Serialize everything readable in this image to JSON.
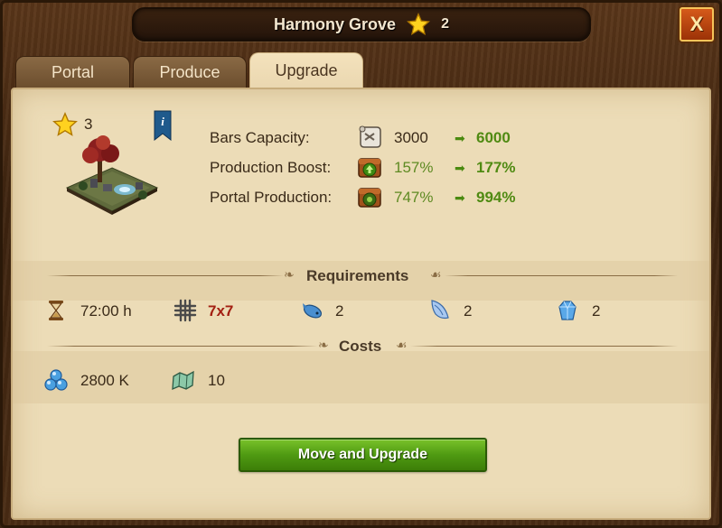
{
  "window": {
    "title": "Harmony Grove",
    "star_count": "2",
    "close_label": "X"
  },
  "tabs": [
    {
      "label": "Portal",
      "active": false
    },
    {
      "label": "Produce",
      "active": false
    },
    {
      "label": "Upgrade",
      "active": true
    }
  ],
  "building": {
    "level": "3",
    "info_icon": "info-bookmark-icon"
  },
  "stats": [
    {
      "label": "Bars Capacity:",
      "icon": "scroll-icon",
      "old": "3000",
      "new": "6000",
      "old_color": "#3a2a18"
    },
    {
      "label": "Production Boost:",
      "icon": "boost-chest-icon",
      "old": "157%",
      "new": "177%",
      "old_color": "#5e8a22"
    },
    {
      "label": "Portal Production:",
      "icon": "portal-chest-icon",
      "old": "747%",
      "new": "994%",
      "old_color": "#5e8a22"
    }
  ],
  "requirements": {
    "title": "Requirements",
    "items": [
      {
        "icon": "hourglass-icon",
        "value": "72:00 h",
        "color": "#3a2a18"
      },
      {
        "icon": "grid-size-icon",
        "value": "7x7",
        "color": "#a31f12"
      },
      {
        "icon": "blue-fish-icon",
        "value": "2"
      },
      {
        "icon": "wing-icon",
        "value": "2"
      },
      {
        "icon": "crystal-icon",
        "value": "2"
      }
    ]
  },
  "costs": {
    "title": "Costs",
    "items": [
      {
        "icon": "orb-cluster-icon",
        "value": "2800 K"
      },
      {
        "icon": "map-icon",
        "value": "10"
      }
    ]
  },
  "action": {
    "label": "Move and Upgrade"
  },
  "colors": {
    "accent_green": "#4f8a12",
    "warning_red": "#a31f12",
    "panel_bg": "#ecdcb7"
  }
}
